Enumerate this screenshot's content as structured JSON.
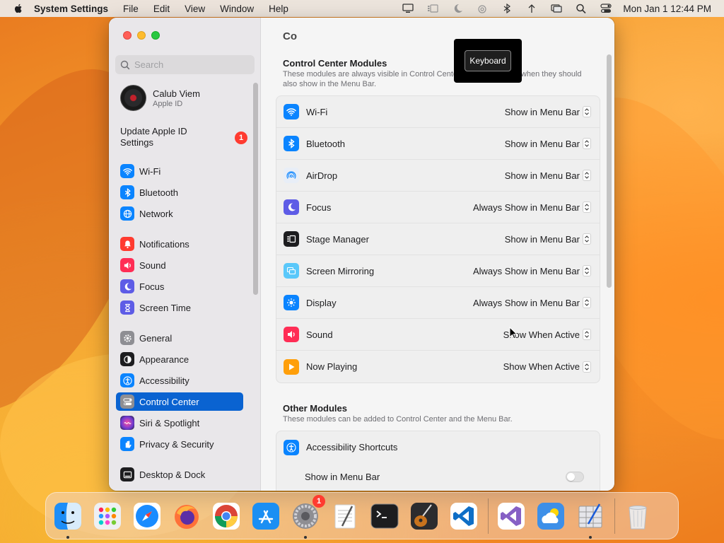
{
  "menubar": {
    "app_name": "System Settings",
    "menus": [
      "File",
      "Edit",
      "View",
      "Window",
      "Help"
    ],
    "clock": "Mon Jan 1  12:44 PM"
  },
  "sidebar": {
    "search_placeholder": "Search",
    "account": {
      "name": "Calub Viem",
      "subtitle": "Apple ID"
    },
    "update": {
      "label": "Update Apple ID Settings",
      "badge": "1"
    },
    "items": [
      {
        "label": "Wi-Fi",
        "icon": "wifi-icon",
        "color": "#0a84ff"
      },
      {
        "label": "Bluetooth",
        "icon": "bluetooth-icon",
        "color": "#0a84ff"
      },
      {
        "label": "Network",
        "icon": "globe-icon",
        "color": "#0a84ff"
      },
      {
        "label": "Notifications",
        "icon": "bell-icon",
        "color": "#ff3b30"
      },
      {
        "label": "Sound",
        "icon": "speaker-icon",
        "color": "#ff2d55"
      },
      {
        "label": "Focus",
        "icon": "moon-icon",
        "color": "#5e5ce6"
      },
      {
        "label": "Screen Time",
        "icon": "hourglass-icon",
        "color": "#5e5ce6"
      },
      {
        "label": "General",
        "icon": "gear-icon",
        "color": "#8e8e93"
      },
      {
        "label": "Appearance",
        "icon": "appearance-icon",
        "color": "#1d1d1f"
      },
      {
        "label": "Accessibility",
        "icon": "accessibility-icon",
        "color": "#0a84ff"
      },
      {
        "label": "Control Center",
        "icon": "control-center-icon",
        "color": "#8e8e93"
      },
      {
        "label": "Siri & Spotlight",
        "icon": "siri-icon",
        "color": "#6e3ad1"
      },
      {
        "label": "Privacy & Security",
        "icon": "hand-icon",
        "color": "#0a84ff"
      },
      {
        "label": "Desktop & Dock",
        "icon": "dock-icon",
        "color": "#1d1d1f"
      }
    ]
  },
  "main": {
    "title": "Co",
    "tooltip": "Keyboard",
    "control_center_modules": {
      "title": "Control Center Modules",
      "description": "These modules are always visible in Control Center. You can choose when they should also show in the Menu Bar.",
      "rows": [
        {
          "label": "Wi-Fi",
          "value": "Show in Menu Bar",
          "icon": "wifi-icon",
          "color": "#0a84ff"
        },
        {
          "label": "Bluetooth",
          "value": "Show in Menu Bar",
          "icon": "bluetooth-icon",
          "color": "#0a84ff"
        },
        {
          "label": "AirDrop",
          "value": "Show in Menu Bar",
          "icon": "airdrop-icon",
          "color": "#e8eef7"
        },
        {
          "label": "Focus",
          "value": "Always Show in Menu Bar",
          "icon": "moon-icon",
          "color": "#5e5ce6"
        },
        {
          "label": "Stage Manager",
          "value": "Show in Menu Bar",
          "icon": "stage-manager-icon",
          "color": "#1d1d1f"
        },
        {
          "label": "Screen Mirroring",
          "value": "Always Show in Menu Bar",
          "icon": "screen-mirroring-icon",
          "color": "#5ac8fa"
        },
        {
          "label": "Display",
          "value": "Always Show in Menu Bar",
          "icon": "sun-icon",
          "color": "#0a84ff"
        },
        {
          "label": "Sound",
          "value": "Show When Active",
          "icon": "speaker-icon",
          "color": "#ff2d55"
        },
        {
          "label": "Now Playing",
          "value": "Show When Active",
          "icon": "play-icon",
          "color": "#ff9f0a"
        }
      ]
    },
    "other_modules": {
      "title": "Other Modules",
      "description": "These modules can be added to Control Center and the Menu Bar.",
      "rows": [
        {
          "label": "Accessibility Shortcuts",
          "icon": "accessibility-icon",
          "color": "#0a84ff"
        },
        {
          "label": "Show in Menu Bar",
          "toggle": false
        }
      ]
    }
  },
  "dock": {
    "apps": [
      "Finder",
      "Launchpad",
      "Safari",
      "Firefox",
      "Chrome",
      "App Store",
      "System Settings",
      "TextEdit",
      "Terminal",
      "GarageBand",
      "VS Code",
      "Visual Studio",
      "Weather",
      "Script Editor",
      "Trash"
    ],
    "settings_badge": "1"
  }
}
